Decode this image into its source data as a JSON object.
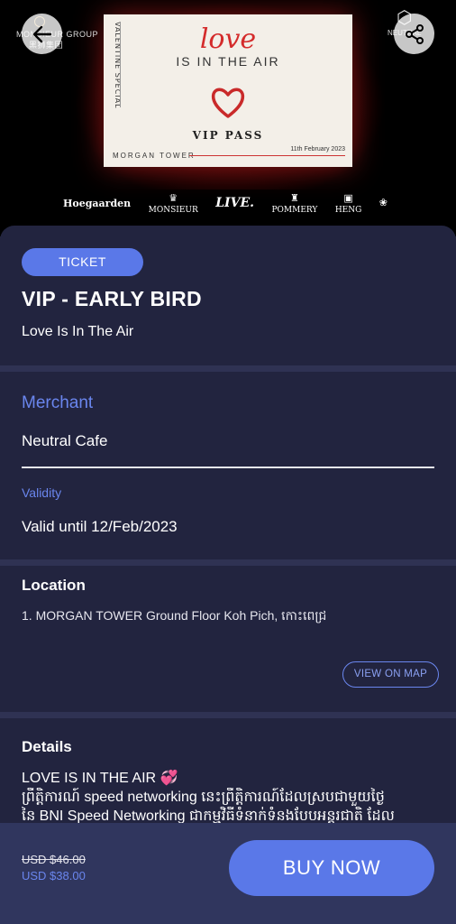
{
  "hero": {
    "logo_left": "MONSIEUR GROUP",
    "logo_left_sub": "黑狮集团",
    "logo_right": "NEUTRAL",
    "poster": {
      "love": "love",
      "air": "IS IN THE AIR",
      "side": "VALENTINE SPECIAL",
      "vip": "VIP PASS",
      "morgan": "MORGAN TOWER",
      "date": "11th February 2023"
    },
    "sponsors": [
      "Hoegaarden",
      "MONSIEUR",
      "LIVE.",
      "POMMERY",
      "HENG"
    ]
  },
  "ticket": {
    "badge": "TICKET",
    "title": "VIP - EARLY BIRD",
    "subtitle": "Love Is In The Air"
  },
  "merchant": {
    "heading": "Merchant",
    "name": "Neutral Cafe",
    "validity_heading": "Validity",
    "validity_value": "Valid until 12/Feb/2023"
  },
  "location": {
    "heading": "Location",
    "address": "1. MORGAN TOWER Ground Floor Koh Pich, កោះពេជ្រ",
    "map_button": "VIEW ON MAP"
  },
  "details": {
    "heading": "Details",
    "line1": "LOVE IS IN THE AIR 💞",
    "line2": "ព្រឹត្តិការណ៍ speed networking នេះព្រឹត្តិការណ៍ដែលស្របជាមួយថ្ងៃ",
    "line3": "នៃ BNI Speed Networking ជាកម្មវិធីទំនាក់ទំនងបែបអន្តរជាតិ ដែល"
  },
  "purchase": {
    "old_price": "USD $46.00",
    "new_price": "USD $38.00",
    "buy_label": "BUY NOW"
  },
  "colors": {
    "accent": "#5a78e8",
    "background": "#22243f",
    "bottom_bar": "#30365e"
  },
  "icons": [
    "back-arrow-icon",
    "share-icon"
  ]
}
